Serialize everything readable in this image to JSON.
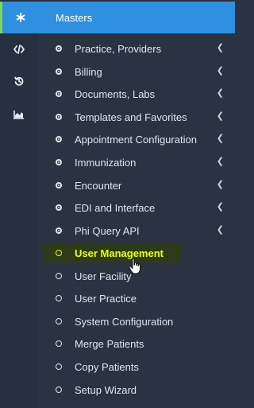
{
  "header": {
    "title": "Masters"
  },
  "rail": {
    "top_icon": "asterisk-icon",
    "icons": [
      "code-icon",
      "history-icon",
      "area-chart-icon"
    ]
  },
  "menu": {
    "groups": [
      {
        "label": "Practice, Providers",
        "icon": "dot-circle-icon"
      },
      {
        "label": "Billing",
        "icon": "dot-circle-icon"
      },
      {
        "label": "Documents, Labs",
        "icon": "dot-circle-icon"
      },
      {
        "label": "Templates and Favorites",
        "icon": "dot-circle-icon"
      },
      {
        "label": "Appointment Configuration",
        "icon": "dot-circle-icon"
      },
      {
        "label": "Immunization",
        "icon": "dot-circle-icon"
      },
      {
        "label": "Encounter",
        "icon": "dot-circle-icon"
      },
      {
        "label": "EDI and Interface",
        "icon": "dot-circle-icon"
      },
      {
        "label": "Phi Query API",
        "icon": "dot-circle-icon"
      }
    ],
    "items": [
      {
        "label": "User Management",
        "active": true
      },
      {
        "label": "User Facility"
      },
      {
        "label": "User Practice"
      },
      {
        "label": "System Configuration"
      },
      {
        "label": "Merge Patients"
      },
      {
        "label": "Copy Patients"
      },
      {
        "label": "Setup Wizard"
      }
    ]
  },
  "colors": {
    "header_bg": "#2f8fe0",
    "sidebar_bg": "#2b3242",
    "active_text": "#f0ff00",
    "active_bg": "#2e3b18",
    "rail_accent": "#7ed957"
  }
}
